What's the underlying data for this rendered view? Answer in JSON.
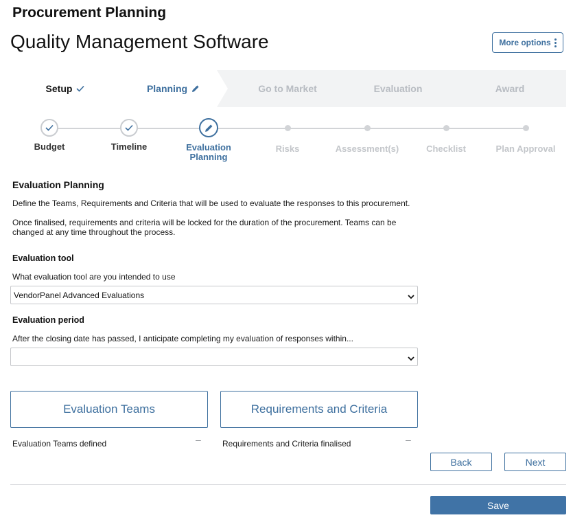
{
  "app_title": "Procurement Planning",
  "page_title": "Quality Management Software",
  "more_options_label": "More options",
  "stages": [
    {
      "label": "Setup",
      "state": "done",
      "icon": "check-icon"
    },
    {
      "label": "Planning",
      "state": "active",
      "icon": "pencil-icon"
    },
    {
      "label": "Go to Market",
      "state": "future"
    },
    {
      "label": "Evaluation",
      "state": "future"
    },
    {
      "label": "Award",
      "state": "future"
    }
  ],
  "steps": [
    {
      "label": "Budget",
      "state": "done"
    },
    {
      "label": "Timeline",
      "state": "done"
    },
    {
      "label": "Evaluation Planning",
      "state": "active"
    },
    {
      "label": "Risks",
      "state": "future"
    },
    {
      "label": "Assessment(s)",
      "state": "future"
    },
    {
      "label": "Checklist",
      "state": "future"
    },
    {
      "label": "Plan Approval",
      "state": "future"
    }
  ],
  "section": {
    "title": "Evaluation Planning",
    "description1": "Define the Teams, Requirements and Criteria that will be used to evaluate the responses to this procurement.",
    "description2": "Once finalised, requirements and criteria will be locked for the duration of the procurement. Teams can be changed at any time throughout the process."
  },
  "evaluation_tool": {
    "title": "Evaluation tool",
    "question": "What evaluation tool are you intended to use",
    "selected": "VendorPanel Advanced Evaluations"
  },
  "evaluation_period": {
    "title": "Evaluation period",
    "question": "After the closing date has passed, I anticipate completing my evaluation of responses within...",
    "selected": ""
  },
  "cards": [
    {
      "label": "Evaluation Teams",
      "status": "Evaluation Teams defined",
      "status_value": "–"
    },
    {
      "label": "Requirements and Criteria",
      "status": "Requirements and Criteria finalised",
      "status_value": "–"
    }
  ],
  "buttons": {
    "back": "Back",
    "next": "Next",
    "save": "Save"
  },
  "colors": {
    "accent": "#3d6f9e",
    "save_bg": "#4073a6",
    "inactive": "#c3c6ca"
  }
}
